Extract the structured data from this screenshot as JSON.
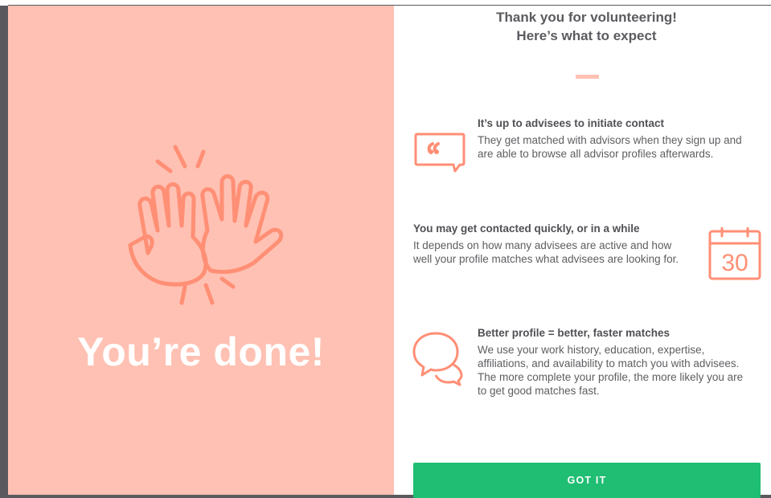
{
  "left_panel": {
    "headline": "You’re done!",
    "background_color": "#ffc1b3",
    "icon": "high-five-icon"
  },
  "right_panel": {
    "title_line1": "Thank you for volunteering!",
    "title_line2": "Here’s what to expect",
    "sections": [
      {
        "icon": "quote-bubble-icon",
        "heading": "It’s up to advisees to initiate contact",
        "body": "They get matched with advisors when they sign up and are able to browse all advisor profiles afterwards."
      },
      {
        "icon": "calendar-icon",
        "calendar_number": "30",
        "heading": "You may get contacted quickly, or in a while",
        "body": "It depends on how many advisees are active and how well your profile matches what advisees are looking for."
      },
      {
        "icon": "chat-bubbles-icon",
        "heading": "Better profile = better, faster matches",
        "body": "We use your work history, education, expertise, affiliations, and availability to match you with advisees. The more complete your profile, the more likely you are to get good matches fast."
      }
    ],
    "button_label": "GOT IT"
  },
  "colors": {
    "accent": "#ff8f75",
    "button": "#1fbe72",
    "text": "#5e5e62"
  }
}
